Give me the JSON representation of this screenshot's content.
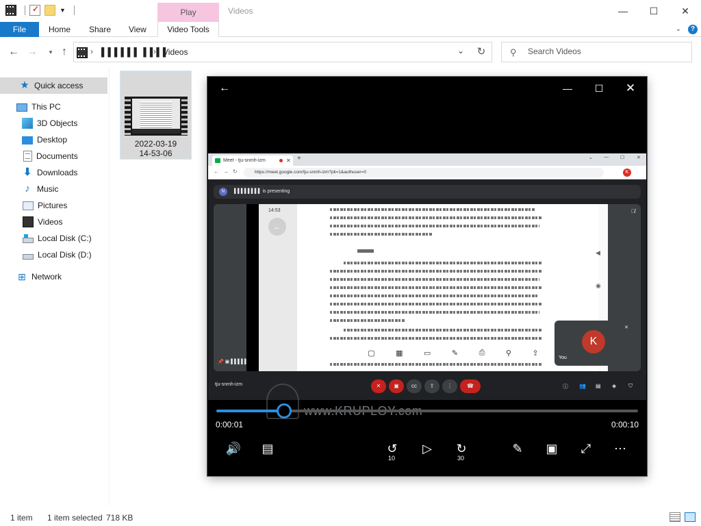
{
  "titlebar": {
    "contextual_tab": "Play",
    "window_title": "Videos",
    "minimize": "—",
    "maximize": "☐",
    "close": "✕"
  },
  "ribbon": {
    "tabs": [
      "File",
      "Home",
      "Share",
      "View",
      "Video Tools"
    ],
    "help": "?"
  },
  "address": {
    "user_crumb": "▌▌▌▌▌▌ ▌▌▌▌",
    "folder": "Videos",
    "search_placeholder": "Search Videos"
  },
  "nav": {
    "items": [
      {
        "label": "Quick access",
        "icon": "star-icon"
      },
      {
        "label": "This PC",
        "icon": "computer-icon"
      },
      {
        "label": "3D Objects",
        "icon": "cube-icon"
      },
      {
        "label": "Desktop",
        "icon": "desktop-icon"
      },
      {
        "label": "Documents",
        "icon": "document-icon"
      },
      {
        "label": "Downloads",
        "icon": "download-icon"
      },
      {
        "label": "Music",
        "icon": "music-icon"
      },
      {
        "label": "Pictures",
        "icon": "pictures-icon"
      },
      {
        "label": "Videos",
        "icon": "video-icon"
      },
      {
        "label": "Local Disk (C:)",
        "icon": "drive-icon"
      },
      {
        "label": "Local Disk (D:)",
        "icon": "drive-icon"
      },
      {
        "label": "Network",
        "icon": "network-icon"
      }
    ]
  },
  "files": [
    {
      "name_line1": "2022-03-19",
      "name_line2": "14-53-06"
    }
  ],
  "status": {
    "items": "1 item",
    "selected": "1 item selected",
    "size": "718 KB"
  },
  "player": {
    "current_time": "0:00:01",
    "total_time": "0:00:10",
    "progress": 0.16,
    "skip_back": "10",
    "skip_forward": "30",
    "watermark": "www.KRUPLOY.com",
    "video": {
      "tab_title": "Meet - tju-snmh-izm",
      "url": "https://meet.google.com/tju-snmh-izm?pli=1&authuser=0",
      "presenter": "▌▌▌▌▌▌▌▌ is presenting",
      "presenter_initial": "N",
      "doc_time": "14:53",
      "you_label": "You",
      "you_initial": "K",
      "avatar_initial": "K",
      "meeting_code": "tju-snmh-izm"
    }
  }
}
